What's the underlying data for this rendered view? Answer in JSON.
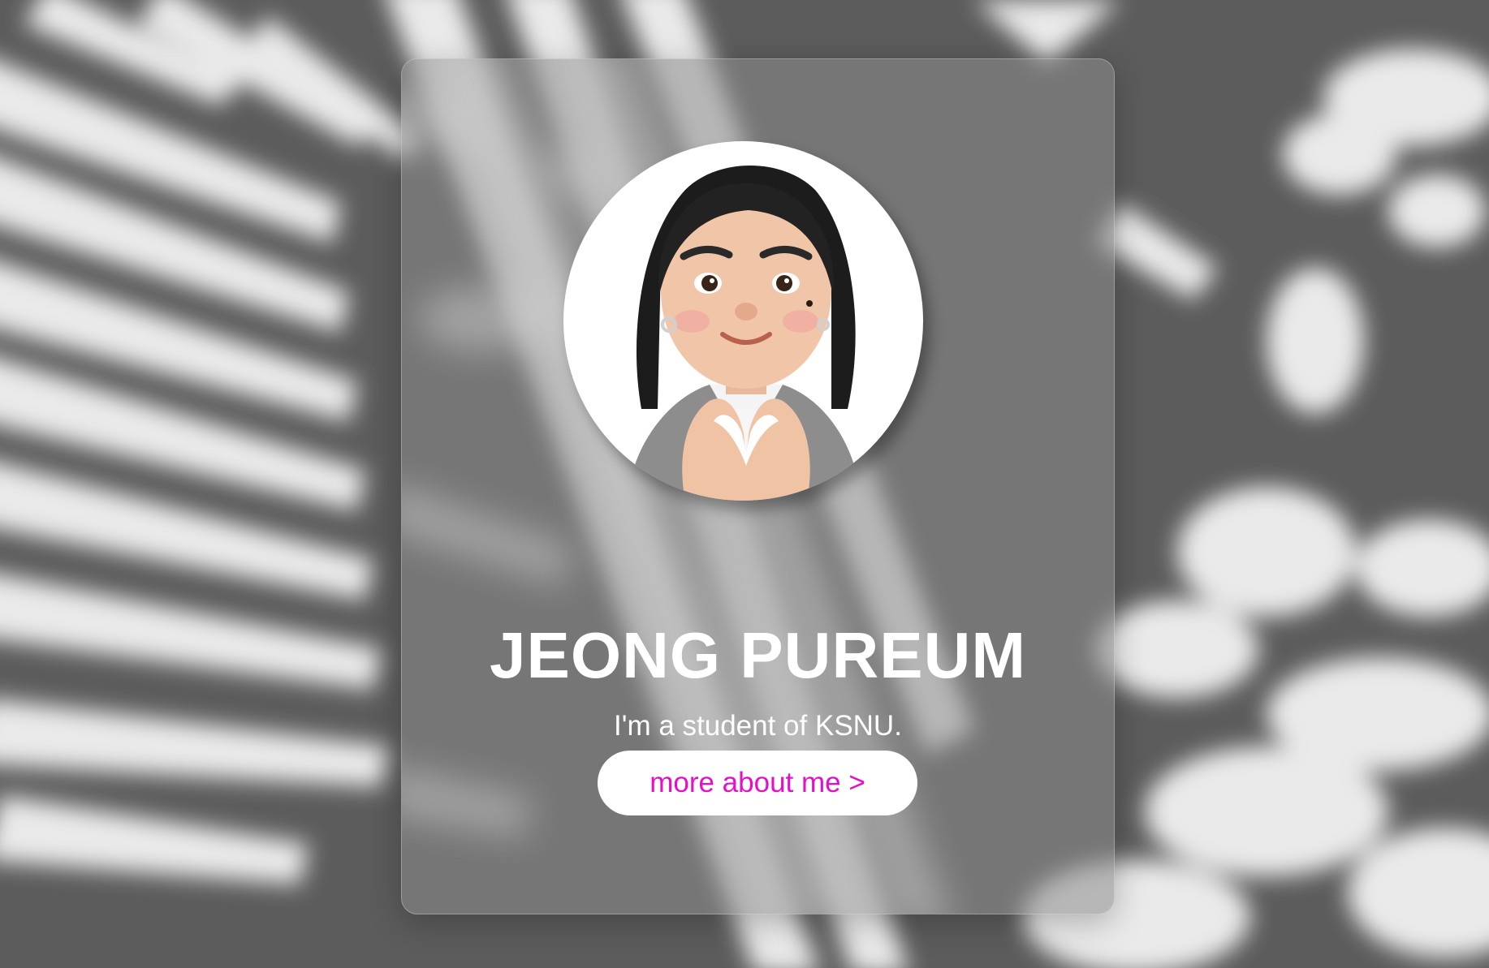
{
  "profile": {
    "name": "JEONG PUREUM",
    "subtitle": "I'm a student of KSNU.",
    "avatar_icon": "memoji-avatar-heart-hands",
    "more_button_label": "more about me >"
  },
  "colors": {
    "background": "#5c5c5c",
    "card": "#8c8c8c",
    "name_text": "#ffffff",
    "button_bg": "#ffffff",
    "button_text": "#e60fc8"
  }
}
